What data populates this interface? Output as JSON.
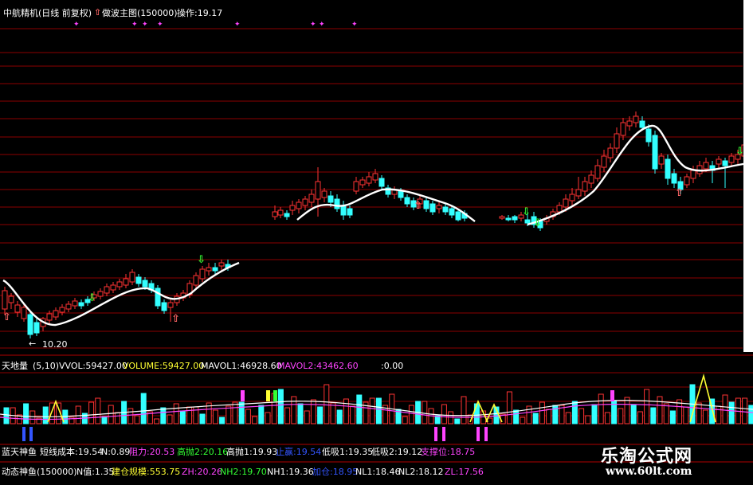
{
  "header": {
    "title": "中航精机(日线 前复权)",
    "indicator": "做波主图(150000)",
    "operation": "操作:19.17",
    "arrow_icon": "up-arrow-icon"
  },
  "main_chart": {
    "low_label": "10.20",
    "colors": {
      "up": "#ff3333",
      "down": "#33ffff",
      "ma": "#ffffff",
      "grid": "#8b0000"
    }
  },
  "volume_panel": {
    "name": "天地量",
    "params": "(5,10)",
    "vvol": "VVOL:59427.00",
    "volume": "VOLUME:59427.00",
    "mavol1": "MAVOL1:46928.60",
    "mavol2": "MAVOL2:43462.60",
    "extra": ":0.00"
  },
  "stats_row1": {
    "name": "蓝天神鱼",
    "items": [
      "短线成本:19.54",
      "N:0.89",
      "阻力:20.53",
      "高抛2:20.16",
      "高抛1:19.93",
      "止赢:19.54",
      "低吸1:19.35",
      "低吸2:19.12",
      "支撑位:18.75"
    ]
  },
  "stats_row2": {
    "name": "动态神鱼(150000)",
    "items": [
      "N值:1.35",
      "建仓规模:553.75",
      "ZH:20.26",
      "NH2:19.70",
      "NH1:19.36",
      "加仓:18.95",
      "NL1:18.46",
      "NL2:18.12",
      "ZL:17.56"
    ]
  },
  "watermark": {
    "title": "乐淘公式网",
    "url": "www.60lt.com"
  }
}
